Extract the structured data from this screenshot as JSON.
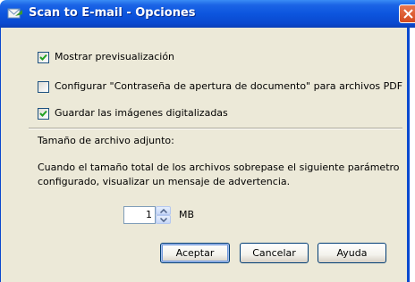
{
  "window": {
    "title": "Scan to E-mail - Opciones"
  },
  "options": [
    {
      "label": "Mostrar previsualización",
      "checked": true
    },
    {
      "label": "Configurar \"Contraseña de apertura de documento\" para archivos PDF",
      "checked": false
    },
    {
      "label": "Guardar las imágenes digitalizadas",
      "checked": true
    }
  ],
  "attachment": {
    "heading": "Tamaño de archivo adjunto:",
    "description_line1": "Cuando el tamaño total de los archivos sobrepase el siguiente parámetro",
    "description_line2": "configurado, visualizar un mensaje de advertencia.",
    "size_value": "1",
    "unit": "MB"
  },
  "buttons": {
    "ok": "Aceptar",
    "cancel": "Cancelar",
    "help": "Ayuda"
  },
  "colors": {
    "titlebar": "#0a49cf",
    "dialog_bg": "#ece9d8",
    "check_mark": "#21a121",
    "close_button": "#d34a1e"
  }
}
